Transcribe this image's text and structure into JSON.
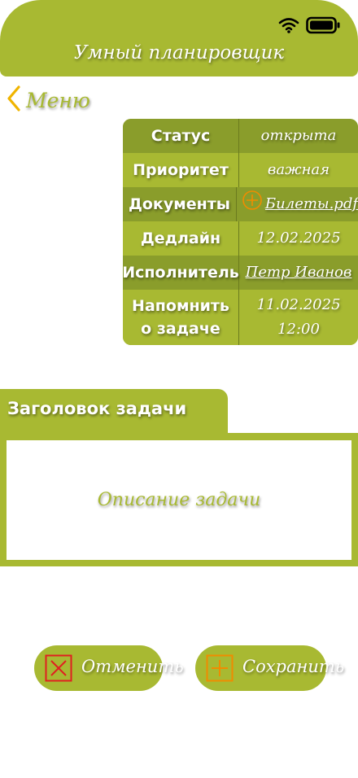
{
  "header": {
    "title": "Умный планировщик",
    "status_icons": [
      "wifi-icon",
      "battery-icon"
    ]
  },
  "nav": {
    "back_label": "Меню"
  },
  "details": {
    "rows": [
      {
        "label": "Статус",
        "value": "открыта"
      },
      {
        "label": "Приоритет",
        "value": "важная"
      },
      {
        "label": "Документы",
        "value": "Билеты.pdf"
      },
      {
        "label": "Дедлайн",
        "value": "12.02.2025"
      },
      {
        "label": "Исполнитель",
        "value": "Петр Иванов"
      },
      {
        "label_line1": "Напомнить",
        "label_line2": "о задаче",
        "value_line1": "11.02.2025",
        "value_line2": "12:00"
      }
    ]
  },
  "task": {
    "title": "Заголовок задачи",
    "description": "Описание задачи"
  },
  "actions": {
    "cancel_label": "Отменить",
    "save_label": "Сохранить"
  },
  "colors": {
    "primary": "#a8b932",
    "primary_dark": "#8a9d2b",
    "back_chevron": "#f0b400",
    "add_icon": "#f08c00",
    "cancel_icon": "#e02020",
    "text_light": "#ffffff"
  }
}
